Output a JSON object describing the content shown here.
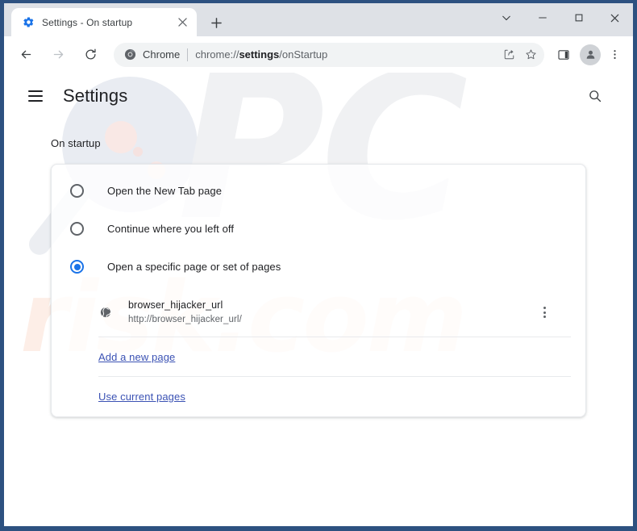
{
  "window": {
    "frame_color": "#2d5180",
    "controls": [
      {
        "name": "tab-search-button",
        "glyph": "chevron-down"
      },
      {
        "name": "minimize-button",
        "glyph": "minimize"
      },
      {
        "name": "maximize-button",
        "glyph": "maximize"
      },
      {
        "name": "close-button",
        "glyph": "close"
      }
    ]
  },
  "tabstrip": {
    "tab": {
      "favicon": "gear-icon",
      "title": "Settings - On startup",
      "close_label": "close-icon"
    },
    "new_tab_label": "new-tab-icon"
  },
  "toolbar": {
    "back_icon": "back-arrow-icon",
    "forward_icon": "forward-arrow-icon",
    "reload_icon": "reload-icon",
    "omnibox": {
      "chrome_icon": "chrome-logo-icon",
      "label": "Chrome",
      "url_prefix": "chrome://",
      "url_bold": "settings",
      "url_suffix": "/onStartup",
      "full_url": "chrome://settings/onStartup",
      "share_icon": "share-icon",
      "bookmark_icon": "star-icon"
    },
    "side_panel_icon": "side-panel-icon",
    "profile_icon": "avatar-icon",
    "menu_icon": "three-dot-menu-icon"
  },
  "settings": {
    "menu_icon": "hamburger-menu-icon",
    "title": "Settings",
    "search_icon": "search-icon",
    "section_label": "On startup",
    "options": [
      {
        "label": "Open the New Tab page",
        "checked": false
      },
      {
        "label": "Continue where you left off",
        "checked": false
      },
      {
        "label": "Open a specific page or set of pages",
        "checked": true
      }
    ],
    "startup_page": {
      "favicon": "globe-icon",
      "name": "browser_hijacker_url",
      "url": "http://browser_hijacker_url/",
      "more_icon": "three-dot-menu-icon"
    },
    "links": {
      "add_page": "Add a new page",
      "use_current": "Use current pages"
    },
    "accent_color": "#1a73e8",
    "link_color": "#3b52b4"
  },
  "watermark": {
    "logo_text": "PC",
    "domain_text": "risk.com"
  }
}
